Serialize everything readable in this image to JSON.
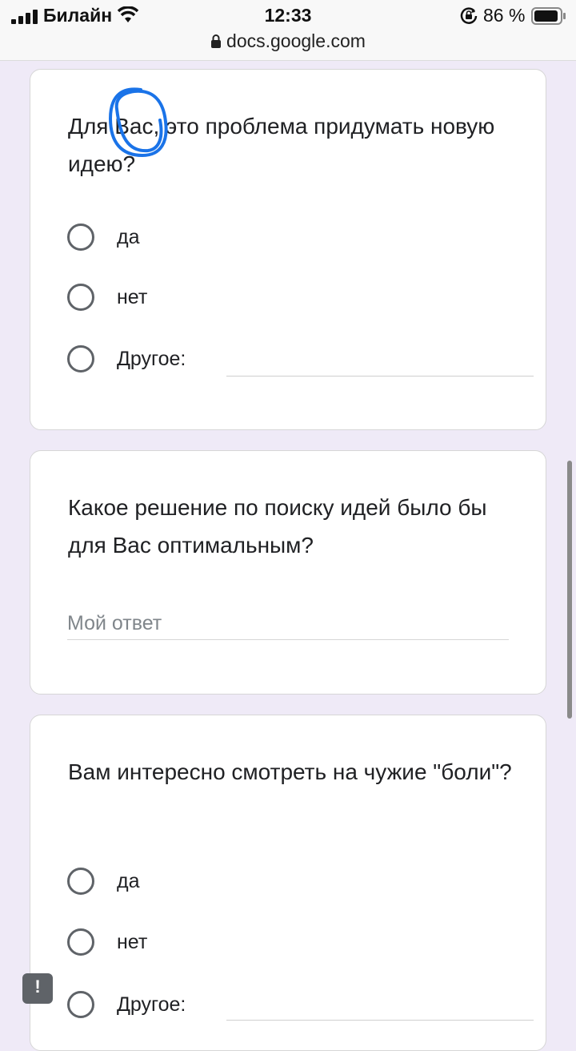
{
  "status_bar": {
    "carrier": "Билайн",
    "time": "12:33",
    "battery": "86 %",
    "url": "docs.google.com"
  },
  "questions": [
    {
      "text": "Для Вас, это проблема придумать новую идею?",
      "options": [
        "да",
        "нет",
        "Другое:"
      ]
    },
    {
      "text": "Какое решение по поиску идей было бы для Вас оптимальным?",
      "placeholder": "Мой ответ"
    },
    {
      "text": "Вам интересно смотреть на чужие \"боли\"?",
      "options": [
        "да",
        "нет",
        "Другое:"
      ]
    }
  ],
  "feedback_icon": "!",
  "colors": {
    "background": "#efeaf7",
    "card": "#ffffff",
    "radio_border": "#5f6368",
    "annotation": "#1a73e8"
  }
}
